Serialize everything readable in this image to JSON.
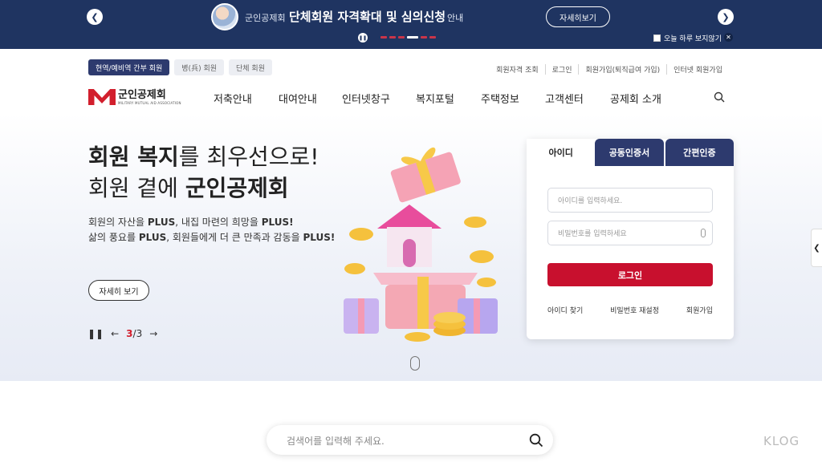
{
  "banner": {
    "org": "군인공제회",
    "headline": "단체회원 자격확대 및 심의신청",
    "guide": "안내",
    "more_label": "자세히보기",
    "today_label": "오늘 하루 보지않기"
  },
  "member_tabs": [
    {
      "label": "현역/예비역 간부 회원"
    },
    {
      "label": "병(兵) 회원"
    },
    {
      "label": "단체 회원"
    }
  ],
  "util_links": [
    {
      "label": "회원자격 조회"
    },
    {
      "label": "로그인"
    },
    {
      "label": "회원가입(퇴직급여 가입)"
    },
    {
      "label": "인터넷 회원가입"
    }
  ],
  "logo": {
    "ko": "군인공제회",
    "en": "MILITARY MUTUAL AID ASSOCIATION"
  },
  "gnb": [
    {
      "label": "저축안내"
    },
    {
      "label": "대여안내"
    },
    {
      "label": "인터넷창구"
    },
    {
      "label": "복지포털"
    },
    {
      "label": "주택정보"
    },
    {
      "label": "고객센터"
    },
    {
      "label": "공제회 소개"
    }
  ],
  "hero": {
    "title1_bold": "회원 복지",
    "title1_rest": "를 최우선으로!",
    "title2_rest": "회원 곁에 ",
    "title2_bold": "군인공제회",
    "desc1_a": "회원의 자산을 ",
    "desc1_b": "PLUS",
    "desc1_c": ", 내집 마련의 희망을 ",
    "desc1_d": "PLUS!",
    "desc2_a": "삶의 풍요를 ",
    "desc2_b": "PLUS",
    "desc2_c": ", 회원들에게 더 큰 만족과 감동을 ",
    "desc2_d": "PLUS!",
    "detail_label": "자세히 보기",
    "slide_current": "3",
    "slide_total": "/3"
  },
  "login": {
    "tabs": [
      {
        "label": "아이디"
      },
      {
        "label": "공동인증서"
      },
      {
        "label": "간편인증"
      }
    ],
    "id_placeholder": "아이디를 입력하세요.",
    "pw_placeholder": "비밀번호를 입력하세요",
    "submit_label": "로그인",
    "links": [
      {
        "label": "아이디 찾기"
      },
      {
        "label": "비밀번호 재설정"
      },
      {
        "label": "회원가입"
      }
    ]
  },
  "search": {
    "placeholder": "검색어를 입력해 주세요."
  },
  "watermark": "KLOG",
  "colors": {
    "navy": "#1f3461",
    "brand_red": "#c8102e",
    "tab_navy": "#2d3a6e"
  }
}
